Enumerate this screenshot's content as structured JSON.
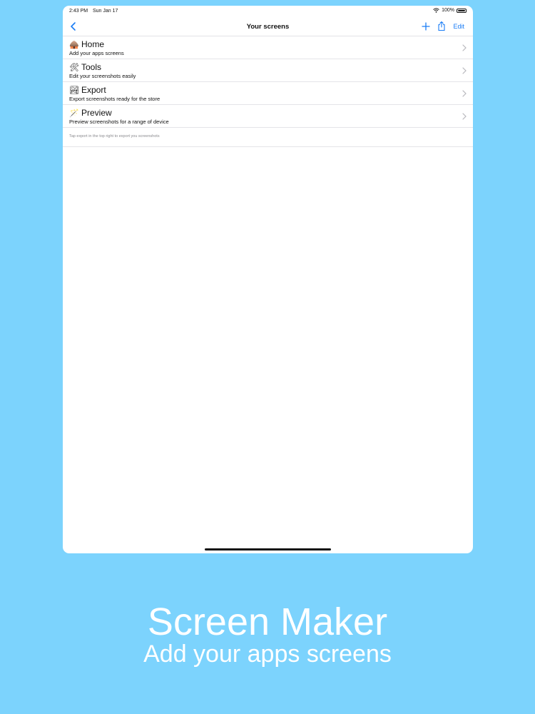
{
  "status_bar": {
    "time": "2:43 PM",
    "date": "Sun Jan 17",
    "battery": "100%"
  },
  "nav": {
    "title": "Your screens",
    "edit_label": "Edit",
    "back_icon": "chevron-left-icon",
    "add_icon": "plus-icon",
    "share_icon": "share-icon"
  },
  "rows": [
    {
      "emoji": "🛖",
      "title": "Home",
      "subtitle": "Add your apps screens"
    },
    {
      "emoji": "🛠",
      "title": "Tools",
      "subtitle": "Edit your screenshots easily"
    },
    {
      "emoji": "🏞",
      "title": "Export",
      "subtitle": "Export screenshots ready for the store"
    },
    {
      "emoji": "🪄",
      "title": "Preview",
      "subtitle": "Preview screenshots for a range of device"
    }
  ],
  "footer_note": "Tap export in the top right to export you screenshots",
  "promo": {
    "title": "Screen Maker",
    "subtitle": "Add your apps screens"
  },
  "colors": {
    "background": "#7cd3fd",
    "accent": "#1a7cf5"
  }
}
